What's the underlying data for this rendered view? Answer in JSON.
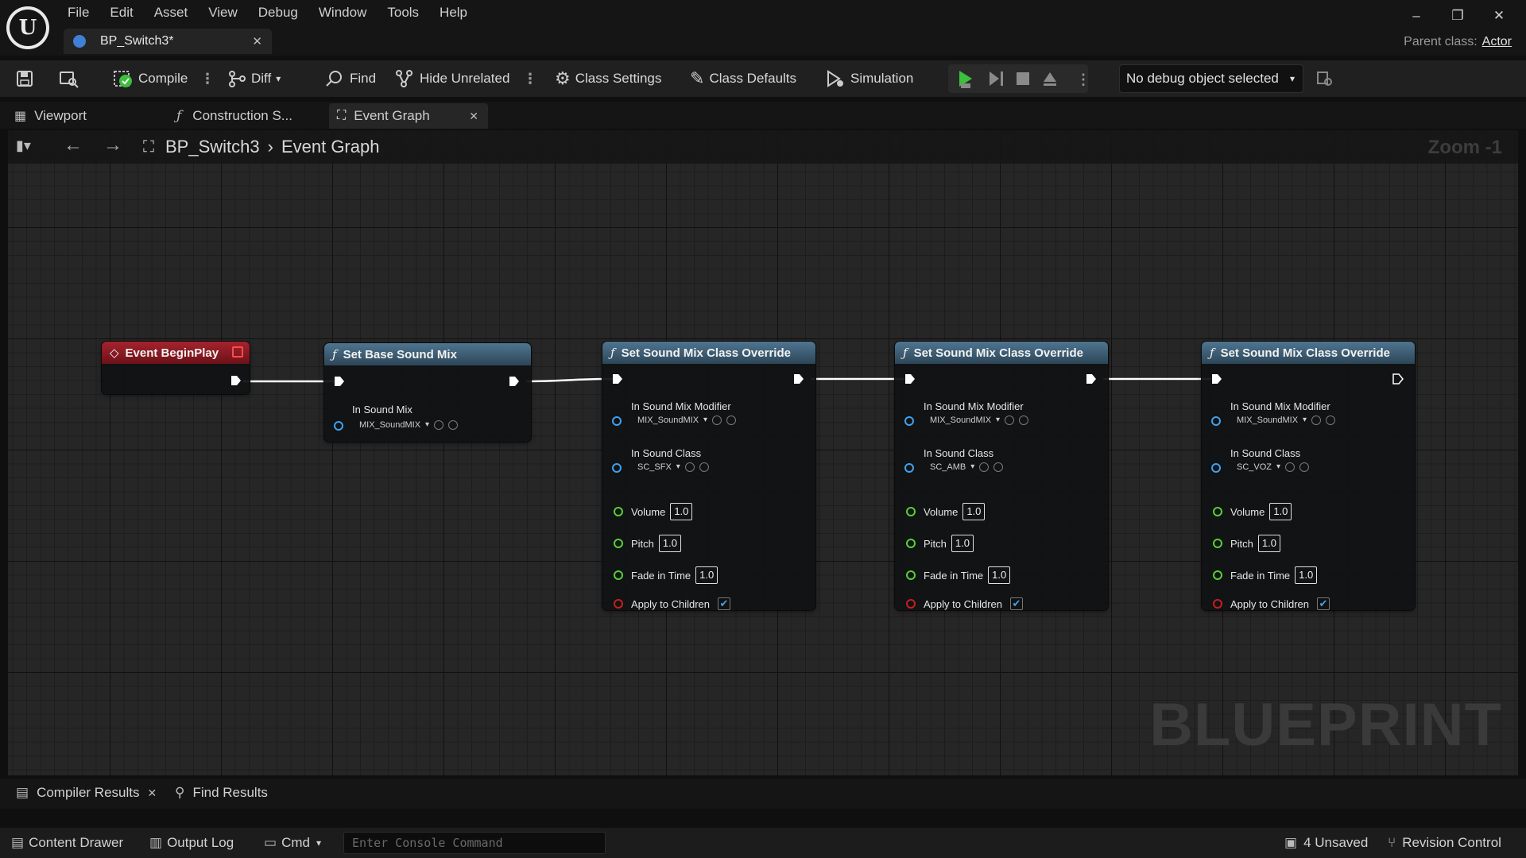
{
  "menu": [
    "File",
    "Edit",
    "Asset",
    "View",
    "Debug",
    "Window",
    "Tools",
    "Help"
  ],
  "document_tab": {
    "title": "BP_Switch3*"
  },
  "parent_class": {
    "label": "Parent class:",
    "value": "Actor"
  },
  "toolbar": {
    "compile": "Compile",
    "diff": "Diff",
    "find": "Find",
    "hide_unrelated": "Hide Unrelated",
    "class_settings": "Class Settings",
    "class_defaults": "Class Defaults",
    "simulation": "Simulation",
    "debug_object": "No debug object selected"
  },
  "editor_tabs": {
    "viewport": "Viewport",
    "construction": "Construction S...",
    "event_graph": "Event Graph"
  },
  "breadcrumb": {
    "blueprint": "BP_Switch3",
    "graph": "Event Graph"
  },
  "zoom": "Zoom -1",
  "watermark": "BLUEPRINT",
  "nodes": {
    "begin_play": {
      "title": "Event BeginPlay"
    },
    "set_base": {
      "title": "Set Base Sound Mix",
      "pin_label": "In Sound Mix",
      "value": "MIX_SoundMIX"
    },
    "override1": {
      "title": "Set Sound Mix Class Override",
      "modifier_label": "In Sound Mix Modifier",
      "modifier_value": "MIX_SoundMIX",
      "class_label": "In Sound Class",
      "class_value": "SC_SFX",
      "volume_label": "Volume",
      "volume": "1.0",
      "pitch_label": "Pitch",
      "pitch": "1.0",
      "fade_label": "Fade in Time",
      "fade": "1.0",
      "apply_label": "Apply to Children",
      "apply_checked": true
    },
    "override2": {
      "title": "Set Sound Mix Class Override",
      "modifier_label": "In Sound Mix Modifier",
      "modifier_value": "MIX_SoundMIX",
      "class_label": "In Sound Class",
      "class_value": "SC_AMB",
      "volume_label": "Volume",
      "volume": "1.0",
      "pitch_label": "Pitch",
      "pitch": "1.0",
      "fade_label": "Fade in Time",
      "fade": "1.0",
      "apply_label": "Apply to Children",
      "apply_checked": true
    },
    "override3": {
      "title": "Set Sound Mix Class Override",
      "modifier_label": "In Sound Mix Modifier",
      "modifier_value": "MIX_SoundMIX",
      "class_label": "In Sound Class",
      "class_value": "SC_VOZ",
      "volume_label": "Volume",
      "volume": "1.0",
      "pitch_label": "Pitch",
      "pitch": "1.0",
      "fade_label": "Fade in Time",
      "fade": "1.0",
      "apply_label": "Apply to Children",
      "apply_checked": true
    }
  },
  "bottom_tabs": {
    "compiler_results": "Compiler Results",
    "find_results": "Find Results"
  },
  "statusbar": {
    "content_drawer": "Content Drawer",
    "output_log": "Output Log",
    "cmd": "Cmd",
    "console_placeholder": "Enter Console Command",
    "unsaved": "4 Unsaved",
    "revision_control": "Revision Control"
  },
  "colors": {
    "exec_wire": "#ffffff",
    "object_pin": "#3fa1f0",
    "float_pin": "#55d135",
    "bool_pin": "#c81e1e",
    "event_header": "#a4232e",
    "function_header": "#4f7590",
    "play_green": "#3cbf3c"
  },
  "icons": {
    "logo": "unreal-engine-logo",
    "save": "save-icon",
    "browse": "browse-icon",
    "compile": "compile-check-icon",
    "diff": "diff-icon",
    "find": "find-icon",
    "hide_unrelated": "hide-unrelated-icon",
    "class_settings": "gear-icon",
    "class_defaults": "pencil-icon",
    "simulation": "simulation-icon",
    "play": "play-icon",
    "step": "step-icon",
    "stop": "stop-icon",
    "eject": "eject-icon"
  }
}
